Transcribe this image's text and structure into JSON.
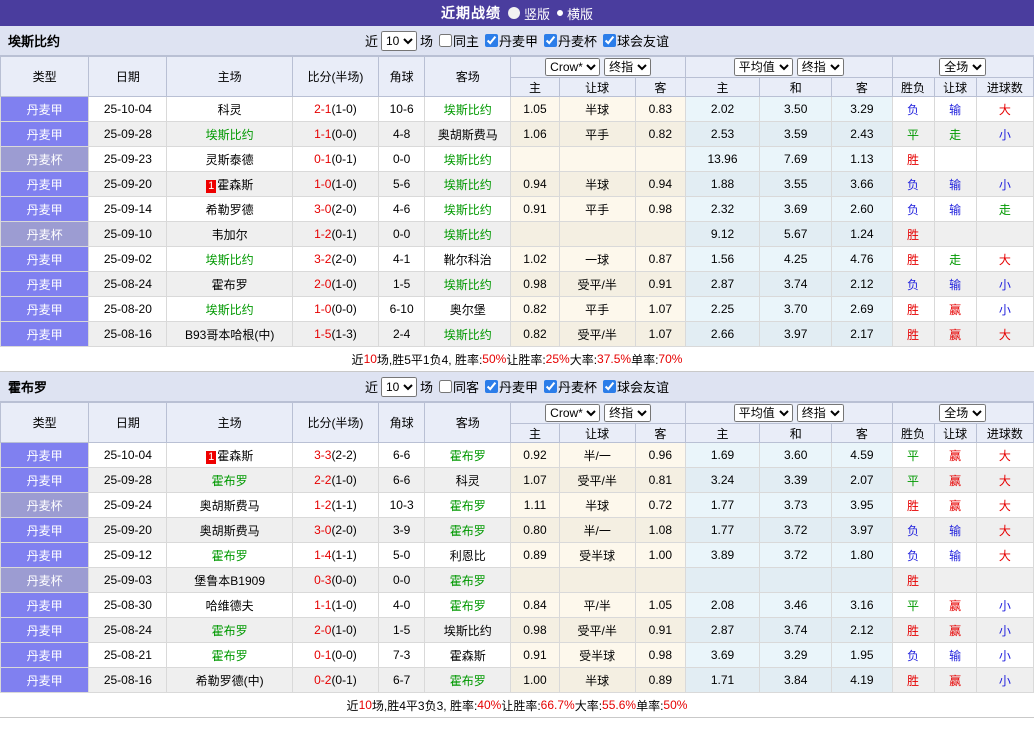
{
  "title_bar": {
    "title": "近期战绩",
    "options": [
      {
        "label": "竖版",
        "selected": true
      },
      {
        "label": "横版",
        "selected": false
      }
    ]
  },
  "colors": {
    "title_bar_bg": "#4a3d9e",
    "league_jia_bg": "#8080f0",
    "league_bei_bg": "#9c9cd2",
    "win_red": "#e60000",
    "loss_blue": "#2222dd",
    "draw_green": "#009900",
    "crow_col_bg": "#fdf8ec",
    "avg_col_bg": "#eaf5fa"
  },
  "table_header": {
    "main_cols": [
      "类型",
      "日期",
      "主场",
      "比分(半场)",
      "角球",
      "客场"
    ],
    "odds_selects": {
      "company": "Crow*",
      "final1": "终指",
      "average": "平均值",
      "final2": "终指",
      "scope": "全场"
    },
    "sub_cols": [
      "主",
      "让球",
      "客",
      "主",
      "和",
      "客",
      "胜负",
      "让球",
      "进球数"
    ]
  },
  "sections": [
    {
      "team": "埃斯比约",
      "filter": {
        "prefix": "近",
        "count": "10",
        "suffix": "场",
        "same": "同主",
        "same_checked": false,
        "leagues": [
          "丹麦甲",
          "丹麦杯",
          "球会友谊"
        ],
        "leagues_checked": [
          true,
          true,
          true
        ]
      },
      "rows": [
        {
          "type": "丹麦甲",
          "tc": "jia",
          "date": "25-10-04",
          "home": "科灵",
          "hc": "",
          "hb": "",
          "score": "2-1",
          "half": "(1-0)",
          "corner": "10-6",
          "away": "埃斯比约",
          "ac": "g",
          "o1": [
            "1.05",
            "半球",
            "0.83"
          ],
          "o2": [
            "2.02",
            "3.50",
            "3.29"
          ],
          "res": [
            [
              "负",
              "b"
            ],
            [
              "输",
              "b"
            ],
            [
              "大",
              "r"
            ]
          ]
        },
        {
          "type": "丹麦甲",
          "tc": "jia",
          "date": "25-09-28",
          "home": "埃斯比约",
          "hc": "g",
          "hb": "",
          "score": "1-1",
          "half": "(0-0)",
          "corner": "4-8",
          "away": "奥胡斯费马",
          "ac": "",
          "o1": [
            "1.06",
            "平手",
            "0.82"
          ],
          "o2": [
            "2.53",
            "3.59",
            "2.43"
          ],
          "res": [
            [
              "平",
              "g"
            ],
            [
              "走",
              "g"
            ],
            [
              "小",
              "b"
            ]
          ]
        },
        {
          "type": "丹麦杯",
          "tc": "bei",
          "date": "25-09-23",
          "home": "灵斯泰德",
          "hc": "",
          "hb": "",
          "score": "0-1",
          "half": "(0-1)",
          "corner": "0-0",
          "away": "埃斯比约",
          "ac": "g",
          "o1": [
            "",
            "",
            ""
          ],
          "o2": [
            "13.96",
            "7.69",
            "1.13"
          ],
          "res": [
            [
              "胜",
              "r"
            ],
            [
              "",
              ""
            ],
            [
              "",
              ""
            ]
          ]
        },
        {
          "type": "丹麦甲",
          "tc": "jia",
          "date": "25-09-20",
          "home": "霍森斯",
          "hc": "",
          "hb": "1",
          "score": "1-0",
          "half": "(1-0)",
          "corner": "5-6",
          "away": "埃斯比约",
          "ac": "g",
          "o1": [
            "0.94",
            "半球",
            "0.94"
          ],
          "o2": [
            "1.88",
            "3.55",
            "3.66"
          ],
          "res": [
            [
              "负",
              "b"
            ],
            [
              "输",
              "b"
            ],
            [
              "小",
              "b"
            ]
          ]
        },
        {
          "type": "丹麦甲",
          "tc": "jia",
          "date": "25-09-14",
          "home": "希勒罗德",
          "hc": "",
          "hb": "",
          "score": "3-0",
          "half": "(2-0)",
          "corner": "4-6",
          "away": "埃斯比约",
          "ac": "g",
          "o1": [
            "0.91",
            "平手",
            "0.98"
          ],
          "o2": [
            "2.32",
            "3.69",
            "2.60"
          ],
          "res": [
            [
              "负",
              "b"
            ],
            [
              "输",
              "b"
            ],
            [
              "走",
              "g"
            ]
          ]
        },
        {
          "type": "丹麦杯",
          "tc": "bei",
          "date": "25-09-10",
          "home": "韦加尔",
          "hc": "",
          "hb": "",
          "score": "1-2",
          "half": "(0-1)",
          "corner": "0-0",
          "away": "埃斯比约",
          "ac": "g",
          "o1": [
            "",
            "",
            ""
          ],
          "o2": [
            "9.12",
            "5.67",
            "1.24"
          ],
          "res": [
            [
              "胜",
              "r"
            ],
            [
              "",
              ""
            ],
            [
              "",
              ""
            ]
          ]
        },
        {
          "type": "丹麦甲",
          "tc": "jia",
          "date": "25-09-02",
          "home": "埃斯比约",
          "hc": "g",
          "hb": "",
          "score": "3-2",
          "half": "(2-0)",
          "corner": "4-1",
          "away": "靴尔科治",
          "ac": "",
          "o1": [
            "1.02",
            "一球",
            "0.87"
          ],
          "o2": [
            "1.56",
            "4.25",
            "4.76"
          ],
          "res": [
            [
              "胜",
              "r"
            ],
            [
              "走",
              "g"
            ],
            [
              "大",
              "r"
            ]
          ]
        },
        {
          "type": "丹麦甲",
          "tc": "jia",
          "date": "25-08-24",
          "home": "霍布罗",
          "hc": "",
          "hb": "",
          "score": "2-0",
          "half": "(1-0)",
          "corner": "1-5",
          "away": "埃斯比约",
          "ac": "g",
          "o1": [
            "0.98",
            "受平/半",
            "0.91"
          ],
          "o2": [
            "2.87",
            "3.74",
            "2.12"
          ],
          "res": [
            [
              "负",
              "b"
            ],
            [
              "输",
              "b"
            ],
            [
              "小",
              "b"
            ]
          ]
        },
        {
          "type": "丹麦甲",
          "tc": "jia",
          "date": "25-08-20",
          "home": "埃斯比约",
          "hc": "g",
          "hb": "",
          "score": "1-0",
          "half": "(0-0)",
          "corner": "6-10",
          "away": "奥尔堡",
          "ac": "",
          "o1": [
            "0.82",
            "平手",
            "1.07"
          ],
          "o2": [
            "2.25",
            "3.70",
            "2.69"
          ],
          "res": [
            [
              "胜",
              "r"
            ],
            [
              "赢",
              "r"
            ],
            [
              "小",
              "b"
            ]
          ]
        },
        {
          "type": "丹麦甲",
          "tc": "jia",
          "date": "25-08-16",
          "home": "B93哥本哈根(中)",
          "hc": "",
          "hb": "",
          "score": "1-5",
          "half": "(1-3)",
          "corner": "2-4",
          "away": "埃斯比约",
          "ac": "g",
          "o1": [
            "0.82",
            "受平/半",
            "1.07"
          ],
          "o2": [
            "2.66",
            "3.97",
            "2.17"
          ],
          "res": [
            [
              "胜",
              "r"
            ],
            [
              "赢",
              "r"
            ],
            [
              "大",
              "r"
            ]
          ]
        }
      ],
      "summary": [
        {
          "t": "近"
        },
        {
          "t": "10",
          "c": "r"
        },
        {
          "t": "场,胜5平1负4, 胜率:"
        },
        {
          "t": "50%",
          "c": "r"
        },
        {
          "t": " 让胜率:"
        },
        {
          "t": "25%",
          "c": "r"
        },
        {
          "t": " 大率:"
        },
        {
          "t": "37.5%",
          "c": "r"
        },
        {
          "t": " 单率:"
        },
        {
          "t": "70%",
          "c": "r"
        }
      ]
    },
    {
      "team": "霍布罗",
      "filter": {
        "prefix": "近",
        "count": "10",
        "suffix": "场",
        "same": "同客",
        "same_checked": false,
        "leagues": [
          "丹麦甲",
          "丹麦杯",
          "球会友谊"
        ],
        "leagues_checked": [
          true,
          true,
          true
        ]
      },
      "rows": [
        {
          "type": "丹麦甲",
          "tc": "jia",
          "date": "25-10-04",
          "home": "霍森斯",
          "hc": "",
          "hb": "1",
          "score": "3-3",
          "half": "(2-2)",
          "corner": "6-6",
          "away": "霍布罗",
          "ac": "g",
          "o1": [
            "0.92",
            "半/一",
            "0.96"
          ],
          "o2": [
            "1.69",
            "3.60",
            "4.59"
          ],
          "res": [
            [
              "平",
              "g"
            ],
            [
              "赢",
              "r"
            ],
            [
              "大",
              "r"
            ]
          ]
        },
        {
          "type": "丹麦甲",
          "tc": "jia",
          "date": "25-09-28",
          "home": "霍布罗",
          "hc": "g",
          "hb": "",
          "score": "2-2",
          "half": "(1-0)",
          "corner": "6-6",
          "away": "科灵",
          "ac": "",
          "o1": [
            "1.07",
            "受平/半",
            "0.81"
          ],
          "o2": [
            "3.24",
            "3.39",
            "2.07"
          ],
          "res": [
            [
              "平",
              "g"
            ],
            [
              "赢",
              "r"
            ],
            [
              "大",
              "r"
            ]
          ]
        },
        {
          "type": "丹麦杯",
          "tc": "bei",
          "date": "25-09-24",
          "home": "奥胡斯费马",
          "hc": "",
          "hb": "",
          "score": "1-2",
          "half": "(1-1)",
          "corner": "10-3",
          "away": "霍布罗",
          "ac": "g",
          "o1": [
            "1.11",
            "半球",
            "0.72"
          ],
          "o2": [
            "1.77",
            "3.73",
            "3.95"
          ],
          "res": [
            [
              "胜",
              "r"
            ],
            [
              "赢",
              "r"
            ],
            [
              "大",
              "r"
            ]
          ]
        },
        {
          "type": "丹麦甲",
          "tc": "jia",
          "date": "25-09-20",
          "home": "奥胡斯费马",
          "hc": "",
          "hb": "",
          "score": "3-0",
          "half": "(2-0)",
          "corner": "3-9",
          "away": "霍布罗",
          "ac": "g",
          "o1": [
            "0.80",
            "半/一",
            "1.08"
          ],
          "o2": [
            "1.77",
            "3.72",
            "3.97"
          ],
          "res": [
            [
              "负",
              "b"
            ],
            [
              "输",
              "b"
            ],
            [
              "大",
              "r"
            ]
          ]
        },
        {
          "type": "丹麦甲",
          "tc": "jia",
          "date": "25-09-12",
          "home": "霍布罗",
          "hc": "g",
          "hb": "",
          "score": "1-4",
          "half": "(1-1)",
          "corner": "5-0",
          "away": "利恩比",
          "ac": "",
          "o1": [
            "0.89",
            "受半球",
            "1.00"
          ],
          "o2": [
            "3.89",
            "3.72",
            "1.80"
          ],
          "res": [
            [
              "负",
              "b"
            ],
            [
              "输",
              "b"
            ],
            [
              "大",
              "r"
            ]
          ]
        },
        {
          "type": "丹麦杯",
          "tc": "bei",
          "date": "25-09-03",
          "home": "堡鲁本B1909",
          "hc": "",
          "hb": "",
          "score": "0-3",
          "half": "(0-0)",
          "corner": "0-0",
          "away": "霍布罗",
          "ac": "g",
          "o1": [
            "",
            "",
            ""
          ],
          "o2": [
            "",
            "",
            ""
          ],
          "res": [
            [
              "胜",
              "r"
            ],
            [
              "",
              ""
            ],
            [
              "",
              ""
            ]
          ]
        },
        {
          "type": "丹麦甲",
          "tc": "jia",
          "date": "25-08-30",
          "home": "哈维德夫",
          "hc": "",
          "hb": "",
          "score": "1-1",
          "half": "(1-0)",
          "corner": "4-0",
          "away": "霍布罗",
          "ac": "g",
          "o1": [
            "0.84",
            "平/半",
            "1.05"
          ],
          "o2": [
            "2.08",
            "3.46",
            "3.16"
          ],
          "res": [
            [
              "平",
              "g"
            ],
            [
              "赢",
              "r"
            ],
            [
              "小",
              "b"
            ]
          ]
        },
        {
          "type": "丹麦甲",
          "tc": "jia",
          "date": "25-08-24",
          "home": "霍布罗",
          "hc": "g",
          "hb": "",
          "score": "2-0",
          "half": "(1-0)",
          "corner": "1-5",
          "away": "埃斯比约",
          "ac": "",
          "o1": [
            "0.98",
            "受平/半",
            "0.91"
          ],
          "o2": [
            "2.87",
            "3.74",
            "2.12"
          ],
          "res": [
            [
              "胜",
              "r"
            ],
            [
              "赢",
              "r"
            ],
            [
              "小",
              "b"
            ]
          ]
        },
        {
          "type": "丹麦甲",
          "tc": "jia",
          "date": "25-08-21",
          "home": "霍布罗",
          "hc": "g",
          "hb": "",
          "score": "0-1",
          "half": "(0-0)",
          "corner": "7-3",
          "away": "霍森斯",
          "ac": "",
          "o1": [
            "0.91",
            "受半球",
            "0.98"
          ],
          "o2": [
            "3.69",
            "3.29",
            "1.95"
          ],
          "res": [
            [
              "负",
              "b"
            ],
            [
              "输",
              "b"
            ],
            [
              "小",
              "b"
            ]
          ]
        },
        {
          "type": "丹麦甲",
          "tc": "jia",
          "date": "25-08-16",
          "home": "希勒罗德(中)",
          "hc": "",
          "hb": "",
          "score": "0-2",
          "half": "(0-1)",
          "corner": "6-7",
          "away": "霍布罗",
          "ac": "g",
          "o1": [
            "1.00",
            "半球",
            "0.89"
          ],
          "o2": [
            "1.71",
            "3.84",
            "4.19"
          ],
          "res": [
            [
              "胜",
              "r"
            ],
            [
              "赢",
              "r"
            ],
            [
              "小",
              "b"
            ]
          ]
        }
      ],
      "summary": [
        {
          "t": "近"
        },
        {
          "t": "10",
          "c": "r"
        },
        {
          "t": "场,胜4平3负3, 胜率:"
        },
        {
          "t": "40%",
          "c": "r"
        },
        {
          "t": " 让胜率:"
        },
        {
          "t": "66.7%",
          "c": "r"
        },
        {
          "t": " 大率:"
        },
        {
          "t": "55.6%",
          "c": "r"
        },
        {
          "t": " 单率:"
        },
        {
          "t": "50%",
          "c": "r"
        }
      ]
    }
  ]
}
